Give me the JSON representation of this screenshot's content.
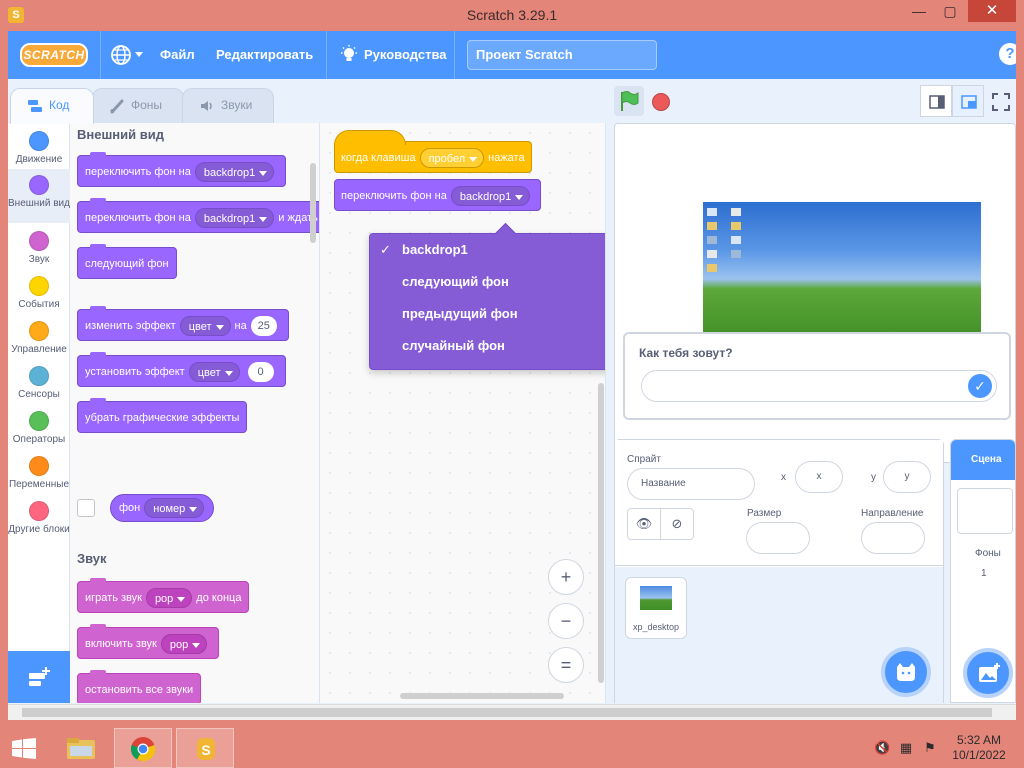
{
  "window": {
    "title": "Scratch 3.29.1"
  },
  "menu": {
    "logo": "SCRATCH",
    "file": "Файл",
    "edit": "Редактировать",
    "tutorials": "Руководства",
    "project_title": "Проект Scratch",
    "help": "?"
  },
  "tabs": {
    "code": "Код",
    "costumes": "Фоны",
    "sounds": "Звуки"
  },
  "categories": [
    {
      "label": "Движение",
      "color": "#4c97ff"
    },
    {
      "label": "Внешний вид",
      "color": "#9966ff"
    },
    {
      "label": "Звук",
      "color": "#cf63cf"
    },
    {
      "label": "События",
      "color": "#ffd500"
    },
    {
      "label": "Управление",
      "color": "#ffab19"
    },
    {
      "label": "Сенсоры",
      "color": "#5cb1d6"
    },
    {
      "label": "Операторы",
      "color": "#59c059"
    },
    {
      "label": "Переменные",
      "color": "#ff8c1a"
    },
    {
      "label": "Другие блоки",
      "color": "#ff6680"
    }
  ],
  "palette": {
    "looks_title": "Внешний вид",
    "switch_backdrop": {
      "text": "переключить фон на",
      "value": "backdrop1"
    },
    "switch_backdrop_wait": {
      "text": "переключить фон на",
      "value": "backdrop1",
      "suffix": "и ждать"
    },
    "next_backdrop": "следующий фон",
    "change_effect": {
      "text": "изменить эффект",
      "value": "цвет",
      "mid": "на",
      "num": "25"
    },
    "set_effect": {
      "text": "установить эффект",
      "value": "цвет",
      "num": "0"
    },
    "clear_effects": "убрать графические эффекты",
    "backdrop_reporter": {
      "text": "фон",
      "value": "номер"
    },
    "sound_title": "Звук",
    "play_until_done": {
      "text": "играть звук",
      "value": "pop",
      "suffix": "до конца"
    },
    "start_sound": {
      "text": "включить звук",
      "value": "pop"
    },
    "stop_all_sounds": "остановить все звуки"
  },
  "script": {
    "hat": {
      "text": "когда клавиша",
      "value": "пробел",
      "suffix": "нажата"
    },
    "switch": {
      "text": "переключить фон на",
      "value": "backdrop1"
    }
  },
  "dropdown": {
    "check": "✓",
    "items": [
      "backdrop1",
      "следующий фон",
      "предыдущий фон",
      "случайный фон"
    ]
  },
  "zoom": {
    "in": "+",
    "out": "−",
    "reset": "="
  },
  "stage": {
    "ask_question": "Как тебя зовут?",
    "ok": "✓"
  },
  "sprite_info": {
    "sprite_label": "Спрайт",
    "name_placeholder": "Название",
    "x_label": "x",
    "x_placeholder": "x",
    "y_label": "y",
    "y_placeholder": "y",
    "size_label": "Размер",
    "direction_label": "Направление",
    "show": "👁",
    "hide": "⊘"
  },
  "sprites": [
    {
      "name": "xp_desktop"
    }
  ],
  "scene": {
    "title": "Сцена",
    "backdrops_label": "Фоны",
    "backdrops_count": "1"
  },
  "taskbar": {
    "time": "5:32 AM",
    "date": "10/1/2022"
  },
  "colors": {
    "accent": "#4c97ff",
    "looks": "#9966ff",
    "sound": "#cf63cf",
    "events": "#ffbf00",
    "chrome": "#e4857a"
  }
}
